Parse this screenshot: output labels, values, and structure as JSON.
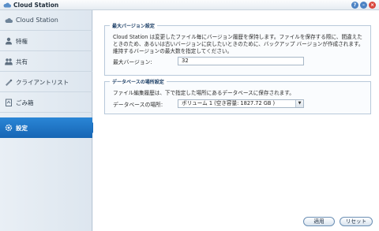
{
  "window": {
    "title": "Cloud Station",
    "help_label": "?",
    "minimize_label": "–",
    "close_label": "×"
  },
  "sidebar": {
    "header": "Cloud Station",
    "items": [
      {
        "label": "特権",
        "icon": "privilege-icon"
      },
      {
        "label": "共有",
        "icon": "shared-folder-icon"
      },
      {
        "label": "クライアントリスト",
        "icon": "client-list-icon"
      },
      {
        "label": "ごみ箱",
        "icon": "recycle-bin-icon"
      },
      {
        "label": "設定",
        "icon": "settings-icon",
        "active": true
      }
    ]
  },
  "versions": {
    "group_title": "最大バージョン設定",
    "description": "Cloud Station は変更したファイル毎にバージョン履歴を保持します。ファイルを保存する際に、間違えたときのため、あるいは古いバージョンに戻したいときのために、バックアップ バージョンが作成されます。維持するバージョンの最大数を指定してください。",
    "max_label": "最大バージョン:",
    "max_value": "32"
  },
  "database": {
    "group_title": "データベースの場所設定",
    "description": "ファイル編集履歴は、下で指定した場所にあるデータベースに保存されます。",
    "location_label": "データベースの場所:",
    "location_value": "ボリューム 1 (空き容量: 1827.72 GB )"
  },
  "buttons": {
    "apply": "適用",
    "reset": "リセット"
  },
  "colors": {
    "accent": "#1a6cbb",
    "close": "#d9463c"
  }
}
